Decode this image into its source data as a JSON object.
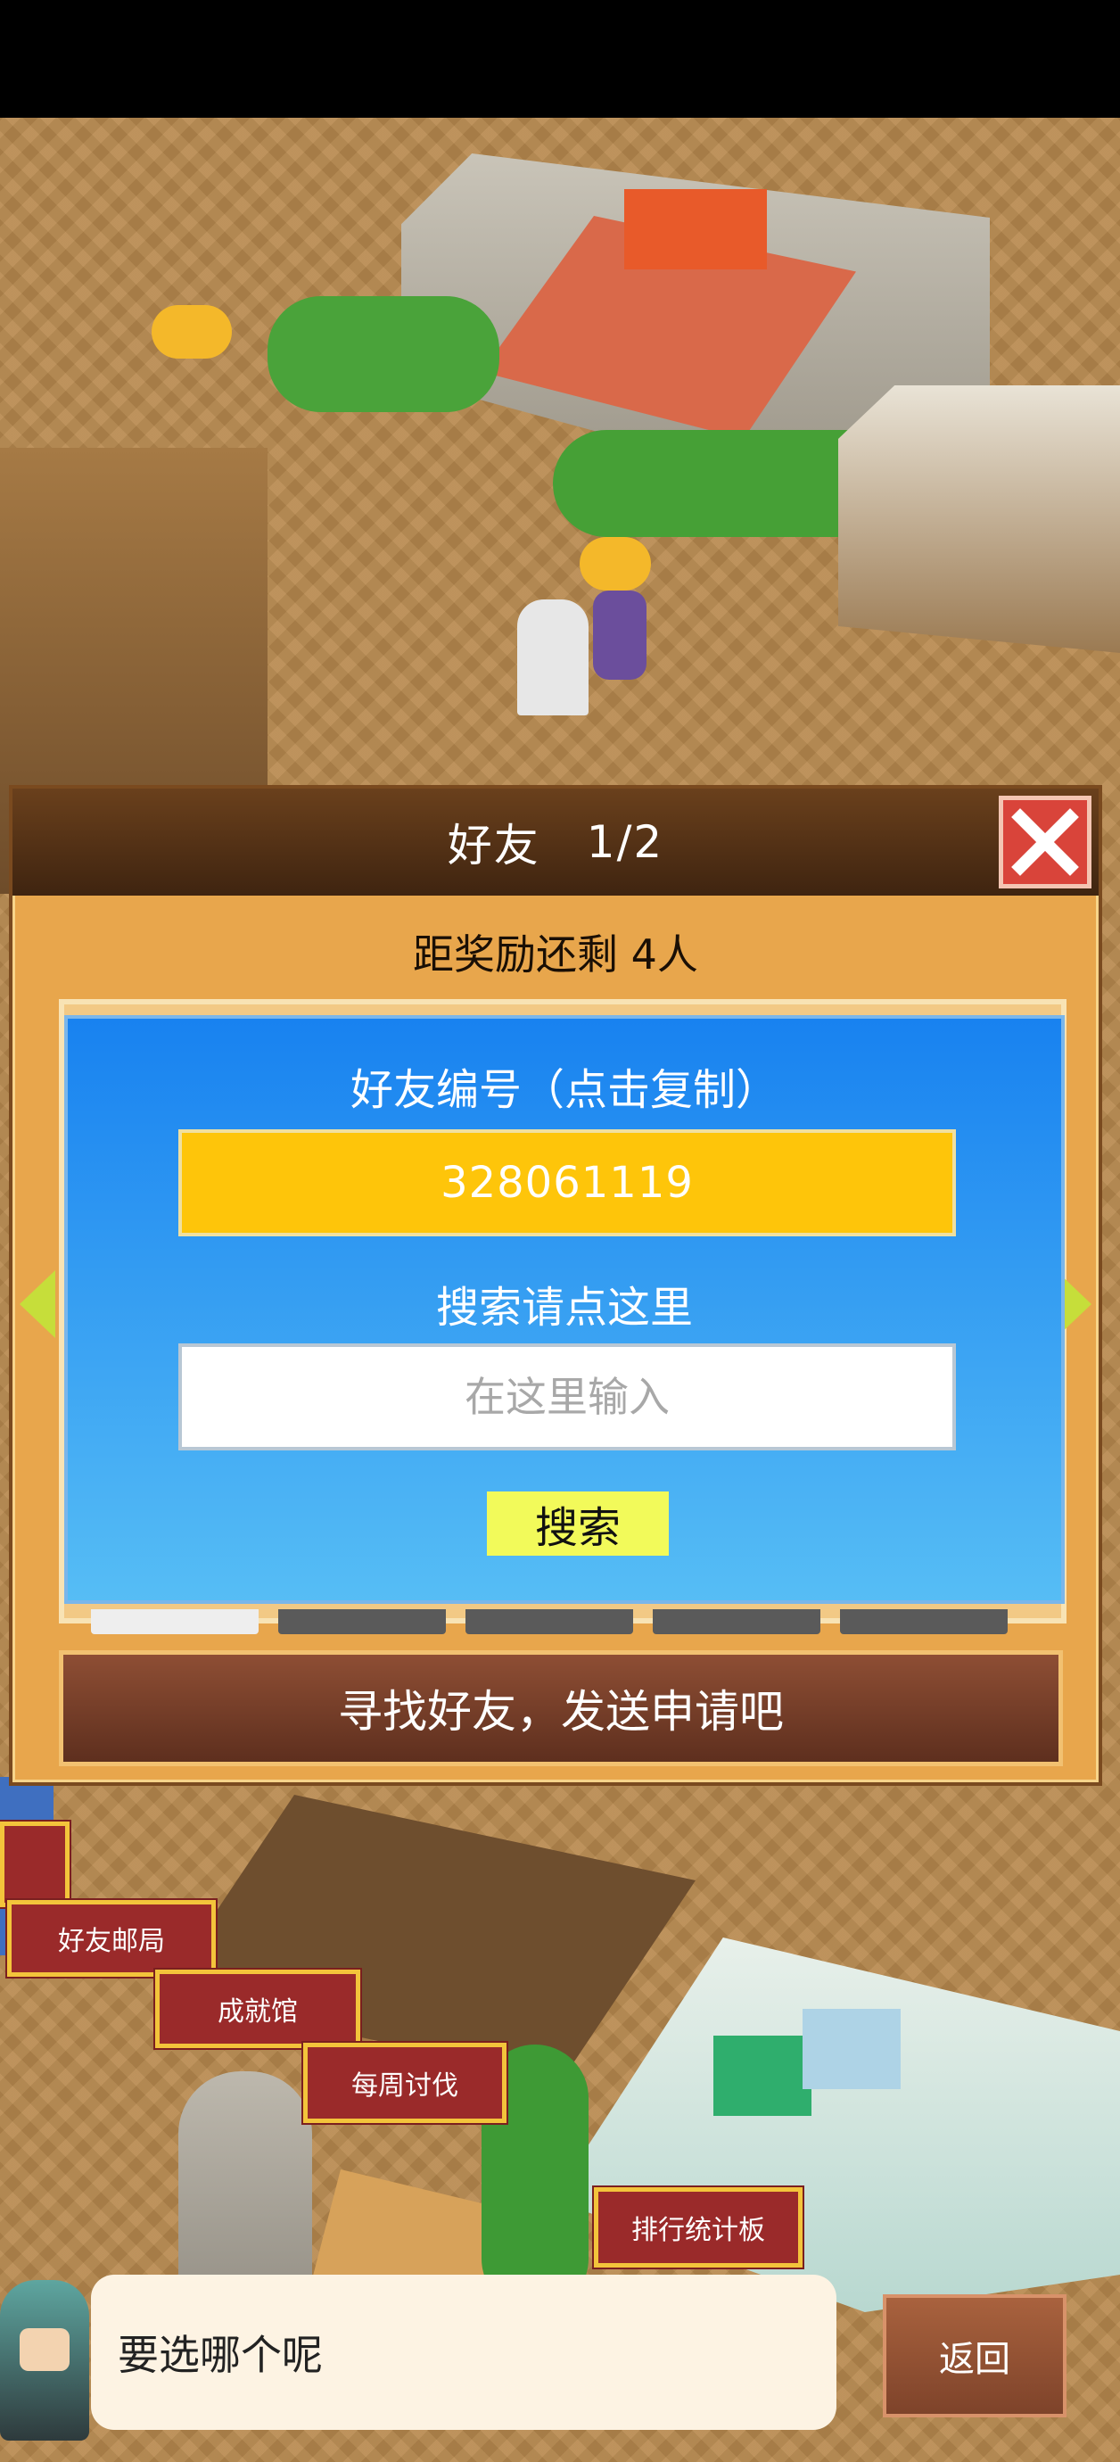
{
  "dialog": {
    "title": "好友",
    "page": "1/2",
    "subtitle": "距奖励还剩 4人",
    "id_label": "好友编号（点击复制）",
    "friend_id": "328061119",
    "search_label": "搜索请点这里",
    "search_placeholder": "在这里输入",
    "search_button": "搜索",
    "find_bar": "寻找好友，发送申请吧",
    "close_icon": "close-icon",
    "nav_icons": [
      "arrow-left-icon",
      "arrow-right-icon"
    ]
  },
  "map_labels": {
    "mail": "好友邮局",
    "achievements": "成就馆",
    "weekly": "每周讨伐",
    "ranking": "排行统计板"
  },
  "bottom": {
    "message": "要选哪个呢",
    "back_button": "返回"
  },
  "colors": {
    "panel_top": "#1882f0",
    "panel_bottom": "#56bdf5",
    "id_box": "#fec50a",
    "search_button": "#f2fa5a",
    "close_button": "#d9443a",
    "tag_fill": "#9a2a2a",
    "tag_border": "#f3c43b"
  }
}
